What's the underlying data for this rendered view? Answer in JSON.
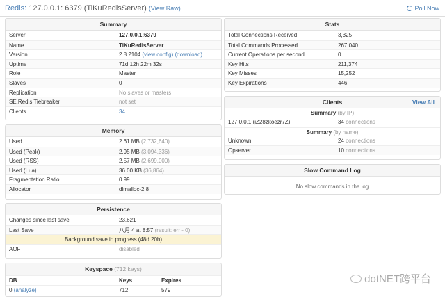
{
  "header": {
    "title_app": "Redis:",
    "title_server": "127.0.0.1: 6379 (TiKuRedisServer)",
    "view_raw": "(View Raw)",
    "poll_now": "Poll Now"
  },
  "summary": {
    "title": "Summary",
    "rows": [
      {
        "k": "Server",
        "v": "127.0.0.1:6379"
      },
      {
        "k": "Name",
        "v": "TiKuRedisServer"
      },
      {
        "k": "Version",
        "v": "2.8.2104",
        "l1": "(view config)",
        "l2": "(download)"
      },
      {
        "k": "Uptime",
        "v": "71d 12h 22m 32s"
      },
      {
        "k": "Role",
        "v": "Master"
      },
      {
        "k": "Slaves",
        "v": "0"
      },
      {
        "k": "Replication",
        "v": "No slaves or masters"
      },
      {
        "k": "SE.Redis Tiebreaker",
        "v": "not set"
      },
      {
        "k": "Clients",
        "v": "34"
      }
    ]
  },
  "memory": {
    "title": "Memory",
    "rows": [
      {
        "k": "Used",
        "v": "2.61 MB",
        "m": "(2,732,640)"
      },
      {
        "k": "Used (Peak)",
        "v": "2.95 MB",
        "m": "(3,094,336)"
      },
      {
        "k": "Used (RSS)",
        "v": "2.57 MB",
        "m": "(2,699,000)"
      },
      {
        "k": "Used (Lua)",
        "v": "36.00 KB",
        "m": "(36,864)"
      },
      {
        "k": "Fragmentation Ratio",
        "v": "0.99"
      },
      {
        "k": "Allocator",
        "v": "dlmalloc-2.8"
      }
    ]
  },
  "persistence": {
    "title": "Persistence",
    "rows": [
      {
        "k": "Changes since last save",
        "v": "23,621"
      },
      {
        "k": "Last Save",
        "v": "八月 4 at 8:57",
        "m": "(result: err - 0)"
      }
    ],
    "notice": "Background save in progress (48d 20h)",
    "aof_k": "AOF",
    "aof_v": "disabled"
  },
  "keyspace": {
    "title": "Keyspace",
    "title_muted": "(712 keys)",
    "headers": [
      "DB",
      "Keys",
      "Expires"
    ],
    "row": {
      "db": "0",
      "analyze": "(analyze)",
      "keys": "712",
      "expires": "579"
    }
  },
  "stats": {
    "title": "Stats",
    "rows": [
      {
        "k": "Total Connections Received",
        "v": "3,325"
      },
      {
        "k": "Total Commands Processed",
        "v": "267,040"
      },
      {
        "k": "Current Operations per second",
        "v": "0"
      },
      {
        "k": "Key Hits",
        "v": "211,374"
      },
      {
        "k": "Key Misses",
        "v": "15,252"
      },
      {
        "k": "Key Expirations",
        "v": "446"
      }
    ]
  },
  "clients": {
    "title": "Clients",
    "view_all": "View All",
    "by_ip_head": "Summary",
    "by_ip_muted": "(by IP)",
    "ip_rows": [
      {
        "k": "127.0.0.1 (iZ28zkoezr7Z)",
        "v": "34",
        "m": "connections"
      }
    ],
    "by_name_head": "Summary",
    "by_name_muted": "(by name)",
    "name_rows": [
      {
        "k": "Unknown",
        "v": "24",
        "m": "connections"
      },
      {
        "k": "Opserver",
        "v": "10",
        "m": "connections"
      }
    ]
  },
  "slowlog": {
    "title": "Slow Command Log",
    "empty": "No slow commands in the log"
  },
  "watermark": "dotNET跨平台"
}
